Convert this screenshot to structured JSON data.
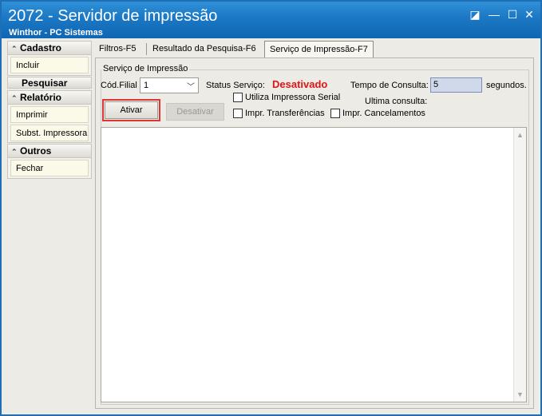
{
  "window": {
    "title": "2072 - Servidor de impressão",
    "subtitle": "Winthor - PC Sistemas",
    "controls": {
      "restore": "◪",
      "minimize": "—",
      "maximize": "☐",
      "close": "✕"
    }
  },
  "sidebar": {
    "cadastro": {
      "header": "Cadastro",
      "items": [
        "Incluir"
      ]
    },
    "pesquisar": "Pesquisar",
    "relatorio": {
      "header": "Relatório",
      "items": [
        "Imprimir",
        "Subst. Impressora"
      ]
    },
    "outros": {
      "header": "Outros",
      "items": [
        "Fechar"
      ]
    }
  },
  "tabs": [
    {
      "label": "Filtros-F5",
      "active": false
    },
    {
      "label": "Resultado da Pesquisa-F6",
      "active": false
    },
    {
      "label": "Serviço de Impressão-F7",
      "active": true
    }
  ],
  "service": {
    "group_title": "Serviço de Impressão",
    "filial_label": "Cód.Filial",
    "filial_value": "1",
    "status_label": "Status Serviço:",
    "status_value": "Desativado",
    "status_color": "#e01515",
    "tempo_label": "Tempo de Consulta:",
    "tempo_value": "5",
    "segundos_label": "segundos.",
    "ultima_label": "Ultima consulta:",
    "check_serial": "Utiliza Impressora Serial",
    "check_transferencias": "Impr. Transferências",
    "check_cancelamentos": "Impr. Cancelamentos",
    "btn_ativar": "Ativar",
    "btn_desativar": "Desativar"
  },
  "icons": {
    "chevron": "chevron-up-icon",
    "scroll_up": "▲",
    "scroll_down": "▼"
  }
}
